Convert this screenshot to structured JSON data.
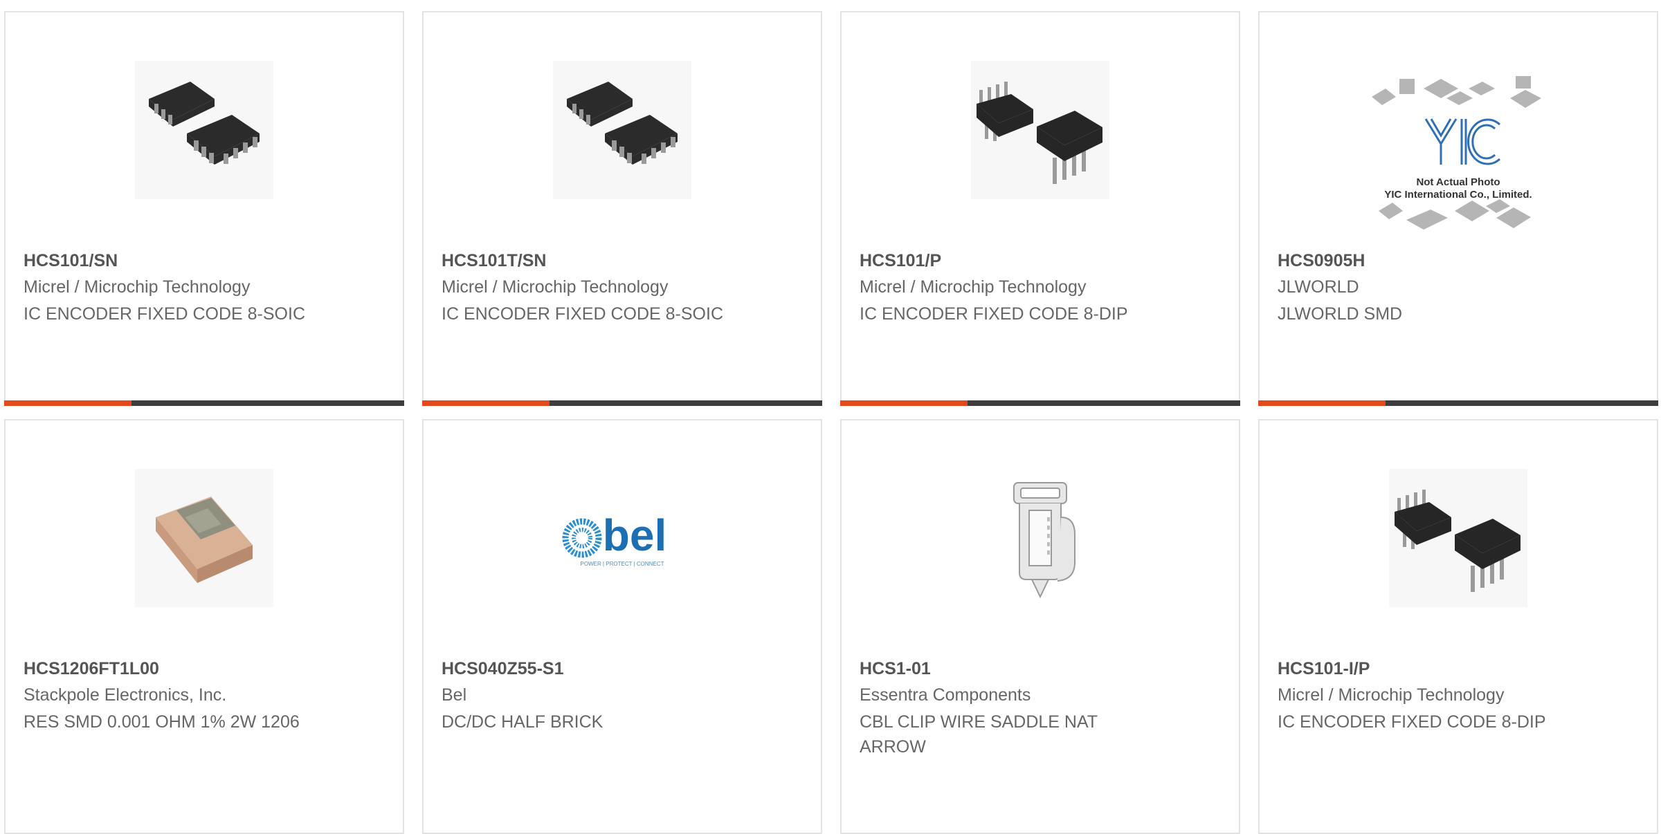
{
  "colors": {
    "accent": "#e24a1c",
    "bar": "#3d3d3d",
    "border": "#e3e3e3",
    "title_text": "#555555",
    "body_text": "#666666"
  },
  "products": [
    {
      "part_number": "HCS101/SN",
      "manufacturer": "Micrel / Microchip Technology",
      "description": "IC ENCODER FIXED CODE 8-SOIC",
      "image_icon": "soic-chip-icon"
    },
    {
      "part_number": "HCS101T/SN",
      "manufacturer": "Micrel / Microchip Technology",
      "description": "IC ENCODER FIXED CODE 8-SOIC",
      "image_icon": "soic-chip-icon"
    },
    {
      "part_number": "HCS101/P",
      "manufacturer": "Micrel / Microchip Technology",
      "description": "IC ENCODER FIXED CODE 8-DIP",
      "image_icon": "dip-chip-icon"
    },
    {
      "part_number": "HCS0905H",
      "manufacturer": "JLWORLD",
      "description": "JLWORLD SMD",
      "image_icon": "placeholder-photo-icon",
      "image_text": {
        "logo": "YIC",
        "line1": "Not Actual Photo",
        "line2": "YIC International Co., Limited."
      }
    },
    {
      "part_number": "HCS1206FT1L00",
      "manufacturer": "Stackpole Electronics, Inc.",
      "description": "RES SMD 0.001 OHM 1% 2W 1206",
      "image_icon": "smd-resistor-icon"
    },
    {
      "part_number": "HCS040Z55-S1",
      "manufacturer": "Bel",
      "description": "DC/DC HALF BRICK",
      "image_icon": "bel-logo-icon",
      "image_text": {
        "logo": "bel",
        "tagline": "POWER | PROTECT | CONNECT"
      }
    },
    {
      "part_number": "HCS1-01",
      "manufacturer": "Essentra Components",
      "description": "CBL CLIP WIRE SADDLE NAT ARROW",
      "image_icon": "cable-clip-icon"
    },
    {
      "part_number": "HCS101-I/P",
      "manufacturer": "Micrel / Microchip Technology",
      "description": "IC ENCODER FIXED CODE 8-DIP",
      "image_icon": "dip-chip-icon"
    }
  ]
}
